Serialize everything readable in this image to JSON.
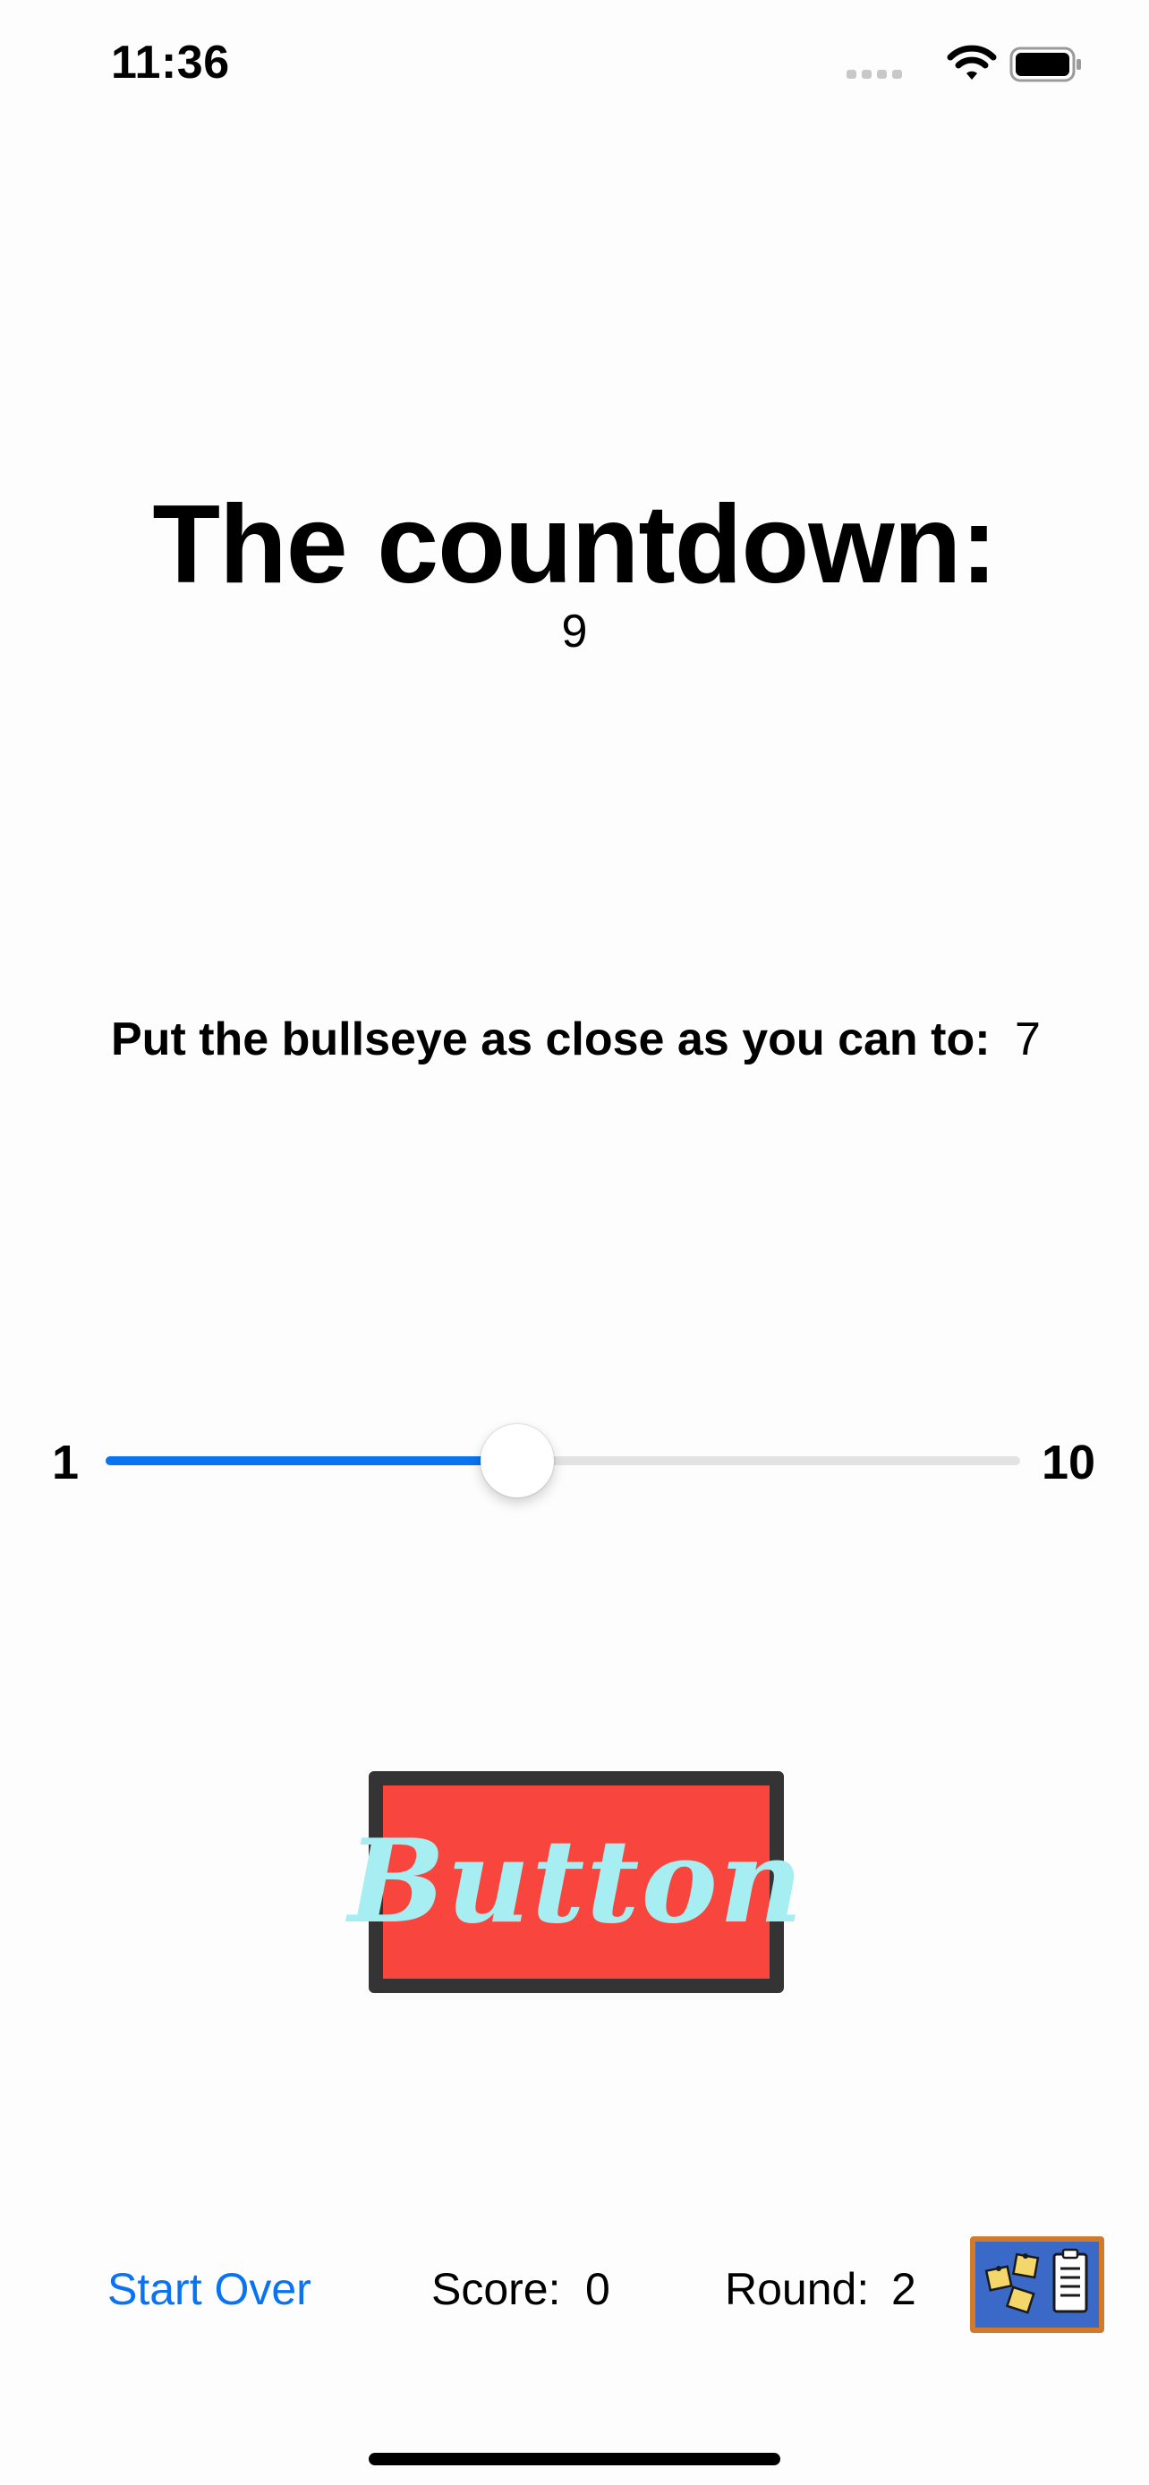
{
  "status_bar": {
    "time": "11:36",
    "icons": [
      "cellular-signal-icon",
      "wifi-icon",
      "battery-icon"
    ]
  },
  "countdown": {
    "title": "The countdown:",
    "value": "9"
  },
  "target": {
    "label": "Put the bullseye as close as you can to:",
    "value": "7"
  },
  "slider": {
    "min_label": "1",
    "max_label": "10",
    "fill_fraction": 0.45
  },
  "hit_button": {
    "label": "Button"
  },
  "bottom_bar": {
    "start_over_label": "Start Over",
    "score_label": "Score:",
    "score_value": "0",
    "round_label": "Round:",
    "round_value": "2",
    "info_icon": "corkboard-info-icon"
  },
  "colors": {
    "accent": "#0a74f0",
    "button_fill": "#f8453e",
    "button_border": "#343434",
    "button_text": "#a6eef1",
    "info_fill": "#3a69c7",
    "info_border": "#d27a2c"
  }
}
